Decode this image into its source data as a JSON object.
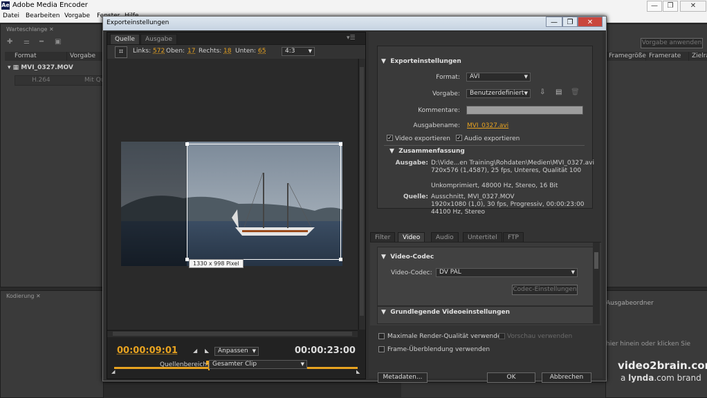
{
  "app": {
    "title": "Adobe Media Encoder",
    "icon_text": "Ae"
  },
  "window_controls": {
    "minimize": "—",
    "maximize": "❐",
    "close": "✕"
  },
  "menu": [
    "Datei",
    "Bearbeiten",
    "Vorgabe",
    "Fenster",
    "Hilfe"
  ],
  "queue_panel": {
    "tab": "Warteschlange",
    "columns": [
      "Format",
      "Vorgabe"
    ],
    "item": "MVI_0327.MOV",
    "sub_format": "H.264",
    "sub_preset": "Mit Qu"
  },
  "encoding_panel": {
    "tab": "Kodierung"
  },
  "right_bg": {
    "apply_preset": "Vorgabe anwenden",
    "columns": [
      "Framegröße",
      "Framerate",
      "Zielra"
    ],
    "output_folder": "Ausgabeordner",
    "drop_hint": "hier hinein oder klicken Sie"
  },
  "watermark": {
    "brand": "video2brain.com",
    "sub_a": "a ",
    "sub_b": "lynda",
    "sub_c": ".com brand"
  },
  "dialog": {
    "title": "Exporteinstellungen",
    "source_tab": "Quelle",
    "output_tab": "Ausgabe",
    "crop": {
      "left_label": "Links:",
      "left": "572",
      "top_label": "Oben:",
      "top": "17",
      "right_label": "Rechts:",
      "right": "18",
      "bottom_label": "Unten:",
      "bottom": "65",
      "ratio": "4:3"
    },
    "crop_tooltip": "1330 x 998 Pixel",
    "timecode_current": "00:00:09:01",
    "timecode_total": "00:00:23:00",
    "fit": "Anpassen",
    "playhead_fraction": 0.39,
    "source_range_label": "Quellenbereich:",
    "source_range": "Gesamter Clip",
    "export_settings": {
      "section": "Exporteinstellungen",
      "format_label": "Format:",
      "format": "AVI",
      "preset_label": "Vorgabe:",
      "preset": "Benutzerdefiniert",
      "comments_label": "Kommentare:",
      "comments": "",
      "output_name_label": "Ausgabename:",
      "output_name": "MVI_0327.avi",
      "export_video": "Video exportieren",
      "export_audio": "Audio exportieren"
    },
    "summary": {
      "section": "Zusammenfassung",
      "output_label": "Ausgabe:",
      "output_lines": [
        "D:\\Vide...en Training\\Rohdaten\\Medien\\MVI_0327.avi",
        "720x576 (1,4587), 25 fps, Unteres, Qualität 100",
        "",
        "Unkomprimiert, 48000 Hz, Stereo, 16 Bit"
      ],
      "source_label": "Quelle:",
      "source_lines": [
        "Ausschnitt, MVI_0327.MOV",
        "1920x1080 (1,0), 30 fps, Progressiv, 00:00:23:00",
        "44100 Hz, Stereo"
      ]
    },
    "tabs": [
      "Filter",
      "Video",
      "Audio",
      "Untertitel",
      "FTP"
    ],
    "video_codec": {
      "section": "Video-Codec",
      "codec_label": "Video-Codec:",
      "codec": "DV PAL",
      "codec_settings": "Codec-Einstellungen"
    },
    "basic_video": {
      "section": "Grundlegende Videoeinstellungen"
    },
    "max_render": "Maximale Render-Qualität verwenden",
    "use_previews": "Vorschau verwenden",
    "frame_blending": "Frame-Überblendung verwenden",
    "metadata_btn": "Metadaten...",
    "ok_btn": "OK",
    "cancel_btn": "Abbrechen"
  }
}
